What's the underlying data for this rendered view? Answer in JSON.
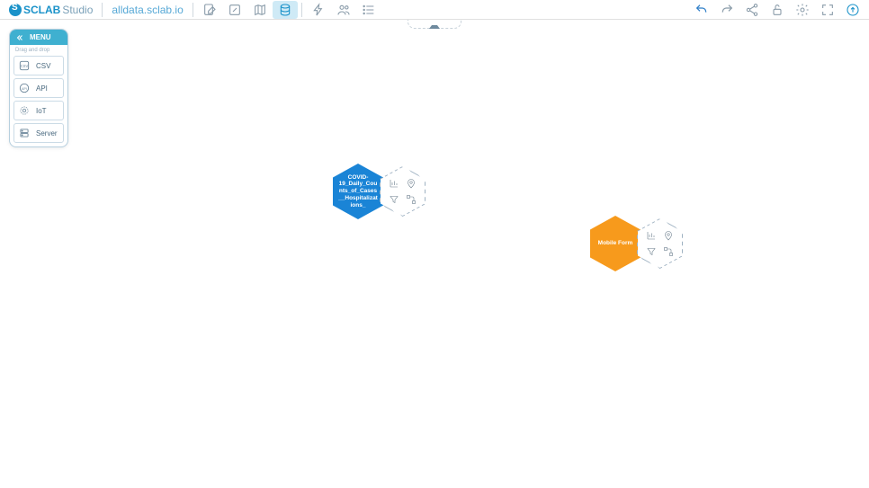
{
  "header": {
    "logoMain": "SCLAB",
    "logoSub": "Studio",
    "projectName": "alldata.sclab.io"
  },
  "sidePanel": {
    "menuLabel": "MENU",
    "hint": "Drag and drop",
    "tiles": [
      {
        "label": "CSV"
      },
      {
        "label": "API"
      },
      {
        "label": "IoT"
      },
      {
        "label": "Server"
      }
    ]
  },
  "nodes": {
    "nodeA": {
      "label": "COVID-19_Daily_Counts_of_Cases__Hospitalizations_"
    },
    "nodeB": {
      "label": "Mobile Form"
    }
  },
  "colors": {
    "brand": "#1a92c9",
    "nodeBlue": "#1a84d6",
    "nodeOrange": "#f79a1c"
  }
}
